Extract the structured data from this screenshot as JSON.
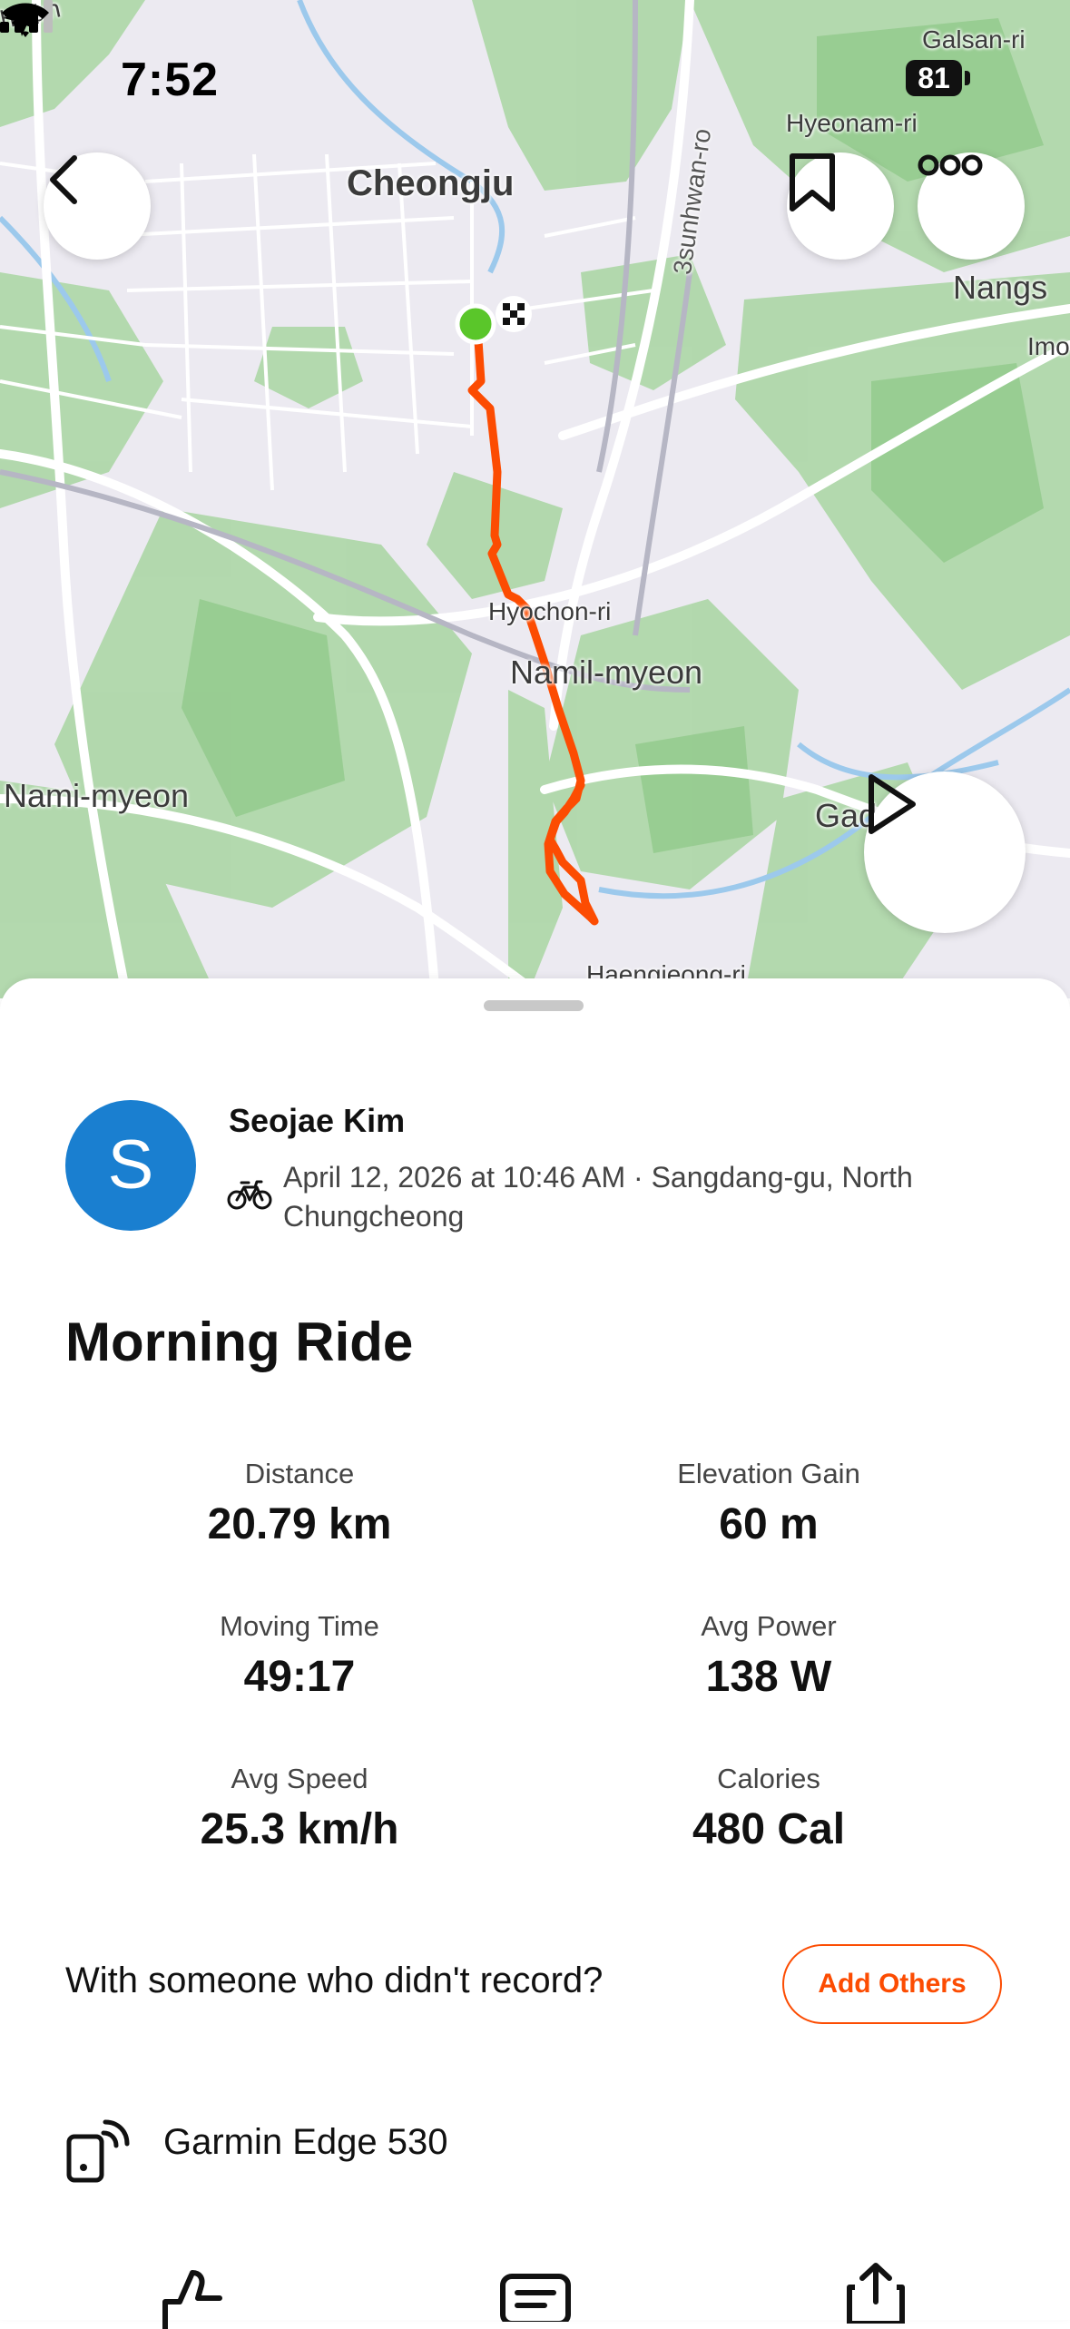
{
  "status_bar": {
    "time": "7:52",
    "battery": "81"
  },
  "map": {
    "labels": {
      "top_left": "hwan",
      "galsan": "Galsan-ri",
      "hyeonam": "Hyeonam-ri",
      "cheongju": "Cheongju",
      "sunhwan": "3sunhwan-ro",
      "nangs": "Nangs",
      "imo": "Imo",
      "hyochon": "Hyochon-ri",
      "namil": "Namil-myeon",
      "nami": "Nami-myeon",
      "gad": "Gad",
      "haengjeong": "Haengjeong-ri"
    },
    "route_color": "#fc4c02",
    "start_color": "#5ac62a"
  },
  "activity": {
    "avatar_letter": "S",
    "athlete_name": "Seojae Kim",
    "meta": "April 12, 2026 at 10:46 AM · Sangdang-gu, North Chungcheong",
    "title": "Morning Ride",
    "stats": [
      {
        "label": "Distance",
        "value": "20.79 km"
      },
      {
        "label": "Elevation Gain",
        "value": "60 m"
      },
      {
        "label": "Moving Time",
        "value": "49:17"
      },
      {
        "label": "Avg Power",
        "value": "138 W"
      },
      {
        "label": "Avg Speed",
        "value": "25.3 km/h"
      },
      {
        "label": "Calories",
        "value": "480 Cal"
      }
    ],
    "with_others_prompt": "With someone who didn't record?",
    "add_others_label": "Add Others",
    "device": "Garmin Edge 530"
  },
  "colors": {
    "accent": "#fc4c02",
    "avatar": "#1a7fd0"
  }
}
